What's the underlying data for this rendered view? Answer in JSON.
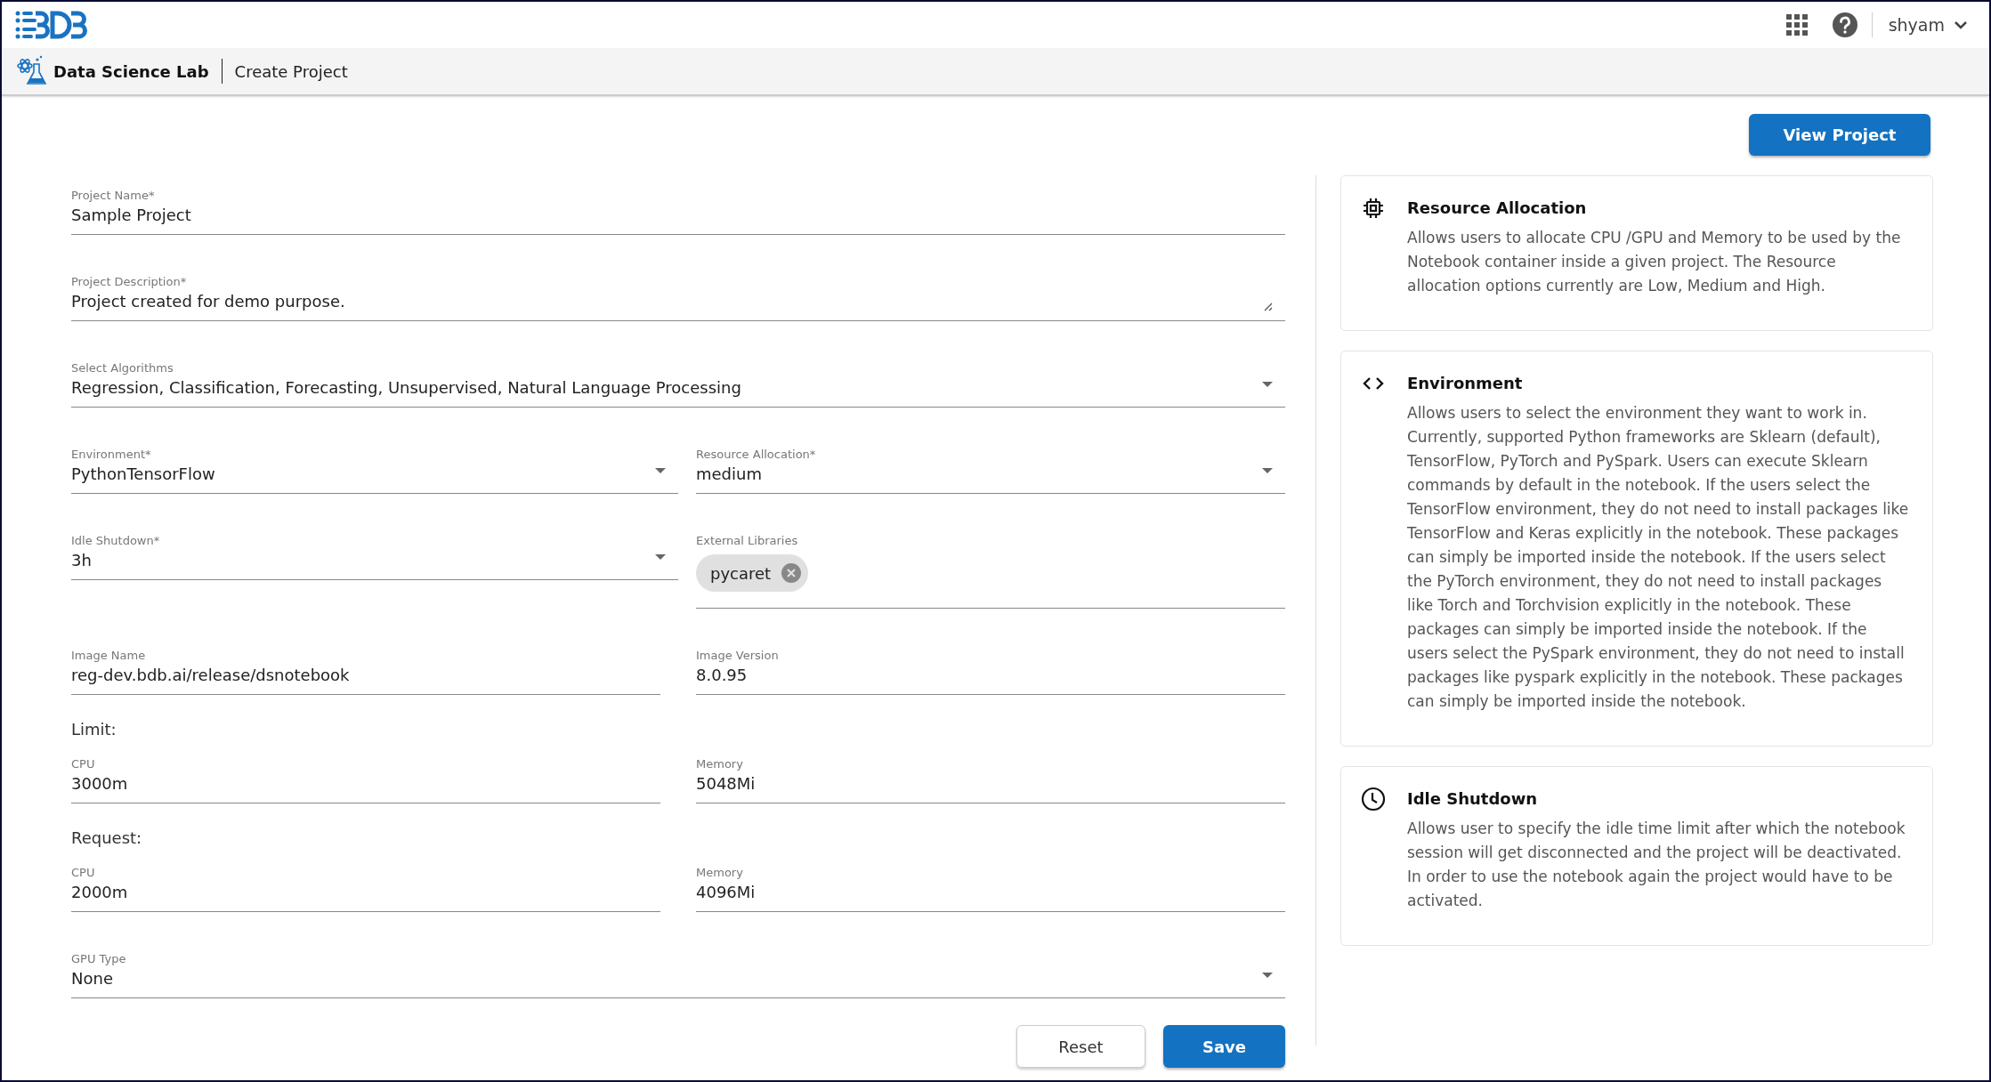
{
  "header": {
    "user": "shyam"
  },
  "breadcrumb": {
    "app": "Data Science Lab",
    "page": "Create Project"
  },
  "view_button": "View Project",
  "form": {
    "rows": [
      [
        {
          "kind": "text",
          "label": "Project Name*",
          "value": "Sample Project"
        }
      ],
      [
        {
          "kind": "textarea",
          "label": "Project Description*",
          "value": "Project created for demo purpose."
        }
      ],
      [
        {
          "kind": "select",
          "label": "Select Algorithms",
          "value": "Regression, Classification, Forecasting, Unsupervised, Natural Language Processing"
        }
      ],
      [
        {
          "kind": "select",
          "label": "Environment*",
          "value": "PythonTensorFlow"
        },
        {
          "kind": "select",
          "label": "Resource Allocation*",
          "value": "medium"
        }
      ],
      [
        {
          "kind": "select",
          "label": "Idle Shutdown*",
          "value": "3h"
        },
        {
          "kind": "chips",
          "label": "External Libraries",
          "chips": [
            "pycaret"
          ]
        }
      ],
      [
        {
          "kind": "text",
          "label": "Image Name",
          "value": "reg-dev.bdb.ai/release/dsnotebook"
        },
        {
          "kind": "text",
          "label": "Image Version",
          "value": "8.0.95"
        }
      ],
      [
        {
          "kind": "heading",
          "text": "Limit:"
        }
      ],
      [
        {
          "kind": "text",
          "label": "CPU",
          "value": "3000m"
        },
        {
          "kind": "text",
          "label": "Memory",
          "value": "5048Mi"
        }
      ],
      [
        {
          "kind": "heading",
          "text": "Request:"
        }
      ],
      [
        {
          "kind": "text",
          "label": "CPU",
          "value": "2000m"
        },
        {
          "kind": "text",
          "label": "Memory",
          "value": "4096Mi"
        }
      ],
      [
        {
          "kind": "select",
          "label": "GPU Type",
          "value": "None"
        }
      ]
    ],
    "buttons": [
      {
        "kind": "secondary",
        "label": "Reset"
      },
      {
        "kind": "primary",
        "label": "Save"
      }
    ]
  },
  "info_cards": [
    {
      "kind": "chip",
      "title": "Resource Allocation",
      "text": "Allows users to allocate CPU /GPU and Memory to be used by the Notebook container inside a given project. The Resource allocation options currently are Low, Medium and High."
    },
    {
      "kind": "code",
      "title": "Environment",
      "text": "Allows users to select the environment they want to work in. Currently, supported Python frameworks are Sklearn (default), TensorFlow, PyTorch and PySpark. Users can execute Sklearn commands by default in the notebook. If the users select the TensorFlow environment, they do not need to install packages like TensorFlow and Keras explicitly in the notebook. These packages can simply be imported inside the notebook. If the users select the PyTorch environment, they do not need to install packages like Torch and Torchvision explicitly in the notebook. These packages can simply be imported inside the notebook. If the users select the PySpark environment, they do not need to install packages like pyspark explicitly in the notebook. These packages can simply be imported inside the notebook."
    },
    {
      "kind": "clock",
      "title": "Idle Shutdown",
      "text": "Allows user to specify the idle time limit after which the notebook session will get disconnected and the project will be deactivated. In order to use the notebook again the project would have to be activated."
    }
  ]
}
